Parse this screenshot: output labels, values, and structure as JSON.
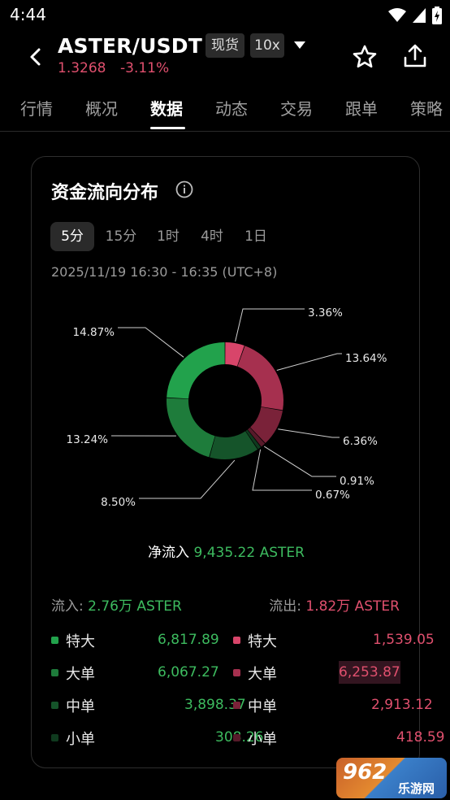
{
  "statusbar": {
    "time": "4:44"
  },
  "header": {
    "pair": "ASTER/USDT",
    "spot_tag": "现货",
    "leverage_tag": "10x",
    "price": "1.3268",
    "change": "-3.11%"
  },
  "tabs": [
    {
      "label": "行情"
    },
    {
      "label": "概况"
    },
    {
      "label": "数据",
      "active": true
    },
    {
      "label": "动态"
    },
    {
      "label": "交易"
    },
    {
      "label": "跟单"
    },
    {
      "label": "策略"
    }
  ],
  "card": {
    "title": "资金流向分布",
    "periods": [
      {
        "label": "5分",
        "active": true
      },
      {
        "label": "15分"
      },
      {
        "label": "1时"
      },
      {
        "label": "4时"
      },
      {
        "label": "1日"
      }
    ],
    "range": "2025/11/19 16:30 - 16:35 (UTC+8)",
    "net_label": "净流入",
    "net_value": "9,435.22 ASTER",
    "inflow_label": "流入:",
    "inflow_value": "2.76万 ASTER",
    "outflow_label": "流出:",
    "outflow_value": "1.82万 ASTER",
    "rows": [
      {
        "in_label": "特大",
        "in_value": "6,817.89",
        "out_label": "特大",
        "out_value": "1,539.05"
      },
      {
        "in_label": "大单",
        "in_value": "6,067.27",
        "out_label": "大单",
        "out_value": "6,253.87"
      },
      {
        "in_label": "中单",
        "in_value": "3,898.37",
        "out_label": "中单",
        "out_value": "2,913.12"
      },
      {
        "in_label": "小单",
        "in_value": "308.26",
        "out_label": "小单",
        "out_value": "418.59"
      }
    ]
  },
  "colors": {
    "up": "#3dbb5f",
    "down": "#e0506e",
    "in_xl": "#22a24c",
    "in_l": "#1e7c3b",
    "in_m": "#15542a",
    "in_s": "#0f3a1e",
    "out_xl": "#d8456a",
    "out_l": "#a6304f",
    "out_m": "#7a2239",
    "out_s": "#571a2a"
  },
  "chart_data": {
    "type": "pie",
    "title": "",
    "slices": [
      {
        "label": "3.36%",
        "value": 3.36,
        "color_key": "out_xl"
      },
      {
        "label": "13.64%",
        "value": 13.64,
        "color_key": "out_l"
      },
      {
        "label": "6.36%",
        "value": 6.36,
        "color_key": "out_m"
      },
      {
        "label": "0.91%",
        "value": 0.91,
        "color_key": "out_s"
      },
      {
        "label": "0.67%",
        "value": 0.67,
        "color_key": "in_s"
      },
      {
        "label": "8.50%",
        "value": 8.5,
        "color_key": "in_m"
      },
      {
        "label": "13.24%",
        "value": 13.24,
        "color_key": "in_l"
      },
      {
        "label": "14.87%",
        "value": 14.87,
        "color_key": "in_xl"
      }
    ]
  },
  "watermark": {
    "line1": "962",
    "line2": "乐游网"
  }
}
